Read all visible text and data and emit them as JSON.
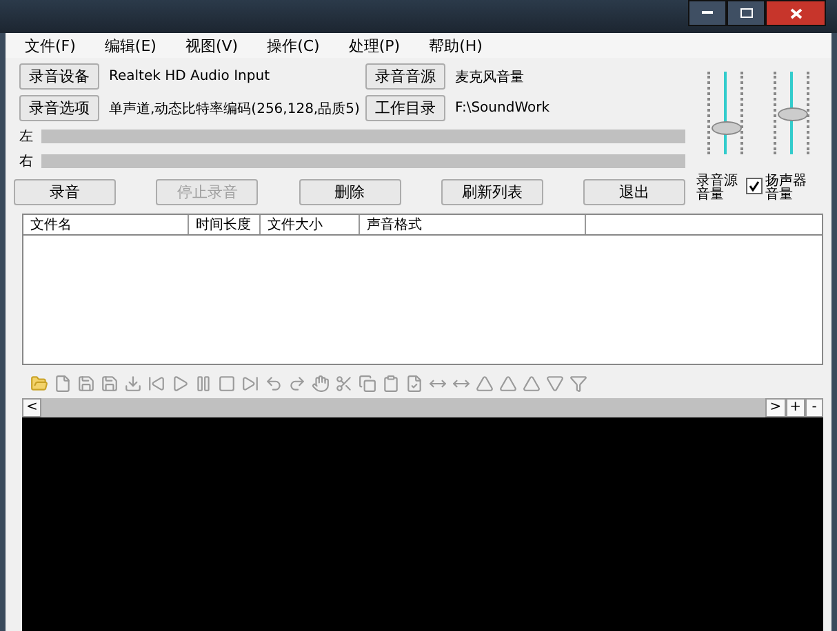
{
  "menu": [
    "文件(F)",
    "编辑(E)",
    "视图(V)",
    "操作(C)",
    "处理(P)",
    "帮助(H)"
  ],
  "settings": [
    {
      "button": "录音设备",
      "value": "Realtek HD Audio Input",
      "button2": "录音音源",
      "value2": "麦克风音量"
    },
    {
      "button": "录音选项",
      "value": "单声道,动态比特率编码(256,128,品质5)",
      "button2": "工作目录",
      "value2": "F:\\SoundWork"
    }
  ],
  "meters": [
    {
      "label": "左"
    },
    {
      "label": "右"
    }
  ],
  "actions": [
    {
      "label": "录音",
      "disabled": false
    },
    {
      "label": "停止录音",
      "disabled": true
    },
    {
      "label": "删除",
      "disabled": false
    },
    {
      "label": "刷新列表",
      "disabled": false
    },
    {
      "label": "退出",
      "disabled": false
    }
  ],
  "sliders": [
    {
      "label": "录音源音量",
      "level": 0.3,
      "checkbox": false
    },
    {
      "label": "扬声器音量",
      "level": 0.5,
      "checkbox": true,
      "checked": true
    }
  ],
  "table": {
    "columns": [
      "文件名",
      "时间长度",
      "文件大小",
      "声音格式"
    ]
  },
  "waveform_scroll": {
    "left": "<",
    "right": ">",
    "plus": "+",
    "minus": "-"
  }
}
